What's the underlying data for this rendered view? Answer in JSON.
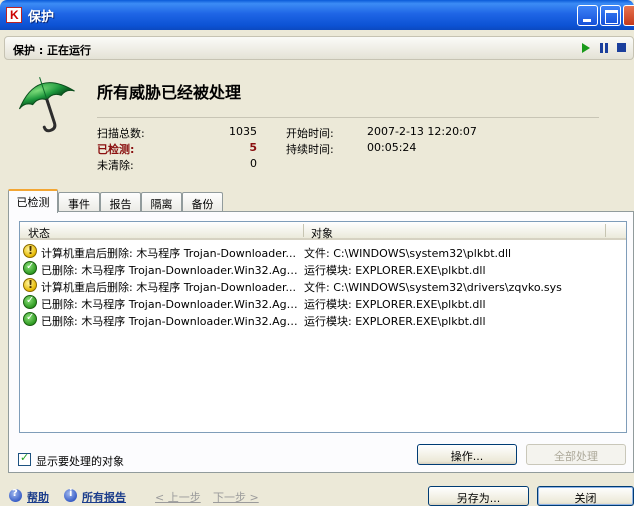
{
  "window": {
    "title": "保护",
    "app_icon": "kaspersky-k-icon"
  },
  "header": {
    "text": "保护 : 正在运行",
    "controls": [
      "play-icon",
      "pause-icon",
      "stop-icon"
    ]
  },
  "summary": {
    "headline": "所有威胁已经被处理",
    "scanned_label": "扫描总数:",
    "scanned_value": "1035",
    "detected_label": "已检测:",
    "detected_value": "5",
    "uncleaned_label": "未清除:",
    "uncleaned_value": "0",
    "start_label": "开始时间:",
    "start_value": "2007-2-13 12:20:07",
    "duration_label": "持续时间:",
    "duration_value": "00:05:24"
  },
  "tabs": [
    "已检测",
    "事件",
    "报告",
    "隔离",
    "备份"
  ],
  "list": {
    "columns": [
      "状态",
      "对象"
    ],
    "rows": [
      {
        "icon": "warning",
        "status": "计算机重启后删除: 木马程序 Trojan-Downloader...",
        "object": "文件: C:\\WINDOWS\\system32\\plkbt.dll"
      },
      {
        "icon": "ok",
        "status": "已删除: 木马程序 Trojan-Downloader.Win32.Age...",
        "object": "运行模块: EXPLORER.EXE\\plkbt.dll"
      },
      {
        "icon": "warning",
        "status": "计算机重启后删除: 木马程序 Trojan-Downloader...",
        "object": "文件: C:\\WINDOWS\\system32\\drivers\\zqvko.sys"
      },
      {
        "icon": "ok",
        "status": "已删除: 木马程序 Trojan-Downloader.Win32.Age...",
        "object": "运行模块: EXPLORER.EXE\\plkbt.dll"
      },
      {
        "icon": "ok",
        "status": "已删除: 木马程序 Trojan-Downloader.Win32.Age...",
        "object": "运行模块: EXPLORER.EXE\\plkbt.dll"
      }
    ]
  },
  "show_objects": {
    "label": "显示要处理的对象",
    "checked": true
  },
  "buttons": {
    "action": "操作...",
    "process_all": "全部处理",
    "save_as": "另存为...",
    "close": "关闭"
  },
  "footer": {
    "help": "帮助",
    "all_reports": "所有报告",
    "prev": "< 上一步",
    "next": "下一步 >"
  }
}
